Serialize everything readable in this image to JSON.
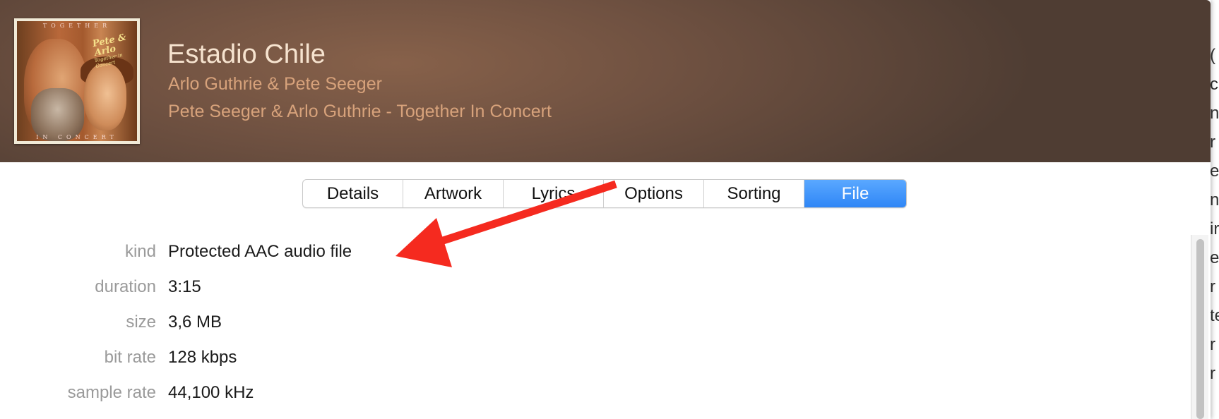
{
  "header": {
    "title": "Estadio Chile",
    "artist": "Arlo Guthrie & Pete Seeger",
    "album": "Pete Seeger & Arlo Guthrie - Together In Concert",
    "artwork": {
      "top_text": "TOGETHER",
      "bottom_text": "IN CONCERT",
      "script_text": "Pete & Arlo",
      "script_subtext": "Together in Concert"
    }
  },
  "tabs": [
    {
      "label": "Details",
      "active": false
    },
    {
      "label": "Artwork",
      "active": false
    },
    {
      "label": "Lyrics",
      "active": false
    },
    {
      "label": "Options",
      "active": false
    },
    {
      "label": "Sorting",
      "active": false
    },
    {
      "label": "File",
      "active": true
    }
  ],
  "file_info": [
    {
      "label": "kind",
      "value": "Protected AAC audio file"
    },
    {
      "label": "duration",
      "value": "3:15"
    },
    {
      "label": "size",
      "value": "3,6 MB"
    },
    {
      "label": "bit rate",
      "value": "128 kbps"
    },
    {
      "label": "sample rate",
      "value": "44,100 kHz"
    }
  ],
  "background_window": {
    "line_fragments": [
      "(",
      "c",
      "n",
      "r",
      "e",
      "n",
      "ir",
      "e",
      "r",
      "te",
      "r",
      "r"
    ]
  },
  "colors": {
    "accent_tab": "#2f86f6",
    "annotation_arrow": "#f52a1f",
    "title_text": "#f6e3cf",
    "subtitle_text": "#d7a27b"
  }
}
